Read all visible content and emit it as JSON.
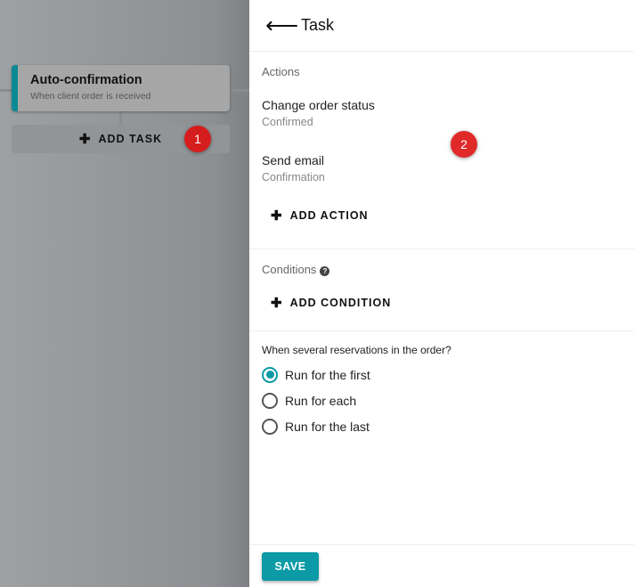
{
  "workflow": {
    "card_title": "Auto-confirmation",
    "card_subtitle": "When client order is received",
    "add_task": "ADD TASK"
  },
  "badges": [
    "1",
    "2"
  ],
  "panel": {
    "title": "Task",
    "actions_label": "Actions",
    "actions": [
      {
        "name": "Change order status",
        "value": "Confirmed"
      },
      {
        "name": "Send email",
        "value": "Confirmation"
      }
    ],
    "add_action": "ADD ACTION",
    "conditions_label": "Conditions",
    "add_condition": "ADD CONDITION",
    "question": "When several reservations in the order?",
    "options": [
      {
        "label": "Run for the first",
        "selected": true
      },
      {
        "label": "Run for each",
        "selected": false
      },
      {
        "label": "Run for the last",
        "selected": false
      }
    ],
    "save": "SAVE"
  },
  "colors": {
    "accent": "#0b9aa6",
    "badge": "#d61d1d"
  }
}
